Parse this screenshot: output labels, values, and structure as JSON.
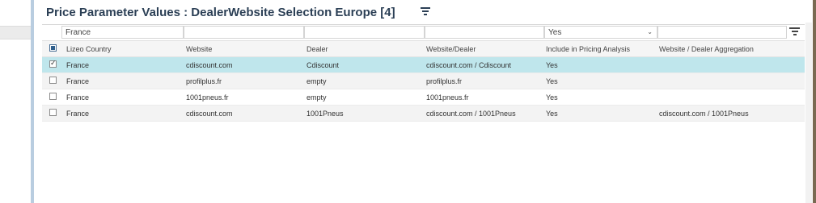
{
  "panel": {
    "title": "Price Parameter Values : DealerWebsite Selection Europe [4]"
  },
  "filters": {
    "country": "France",
    "include": "Yes",
    "include_chevron": "⌄"
  },
  "columns": [
    "Lizeo Country",
    "Website",
    "Dealer",
    "Website/Dealer",
    "Include in Pricing Analysis",
    "Website / Dealer Aggregation"
  ],
  "rows": [
    {
      "checked": true,
      "country": "France",
      "website": "cdiscount.com",
      "dealer": "Cdiscount",
      "website_dealer": "cdiscount.com / Cdiscount",
      "include": "Yes",
      "aggregation": ""
    },
    {
      "checked": false,
      "country": "France",
      "website": "profilplus.fr",
      "dealer": "empty",
      "website_dealer": "profilplus.fr",
      "include": "Yes",
      "aggregation": ""
    },
    {
      "checked": false,
      "country": "France",
      "website": "1001pneus.fr",
      "dealer": "empty",
      "website_dealer": "1001pneus.fr",
      "include": "Yes",
      "aggregation": ""
    },
    {
      "checked": false,
      "country": "France",
      "website": "cdiscount.com",
      "dealer": "1001Pneus",
      "website_dealer": "cdiscount.com / 1001Pneus",
      "include": "Yes",
      "aggregation": "cdiscount.com / 1001Pneus"
    }
  ],
  "colors": {
    "accent": "#2b3f55",
    "selected_row": "#bfe6ec",
    "side_bar": "#b9cde0"
  }
}
